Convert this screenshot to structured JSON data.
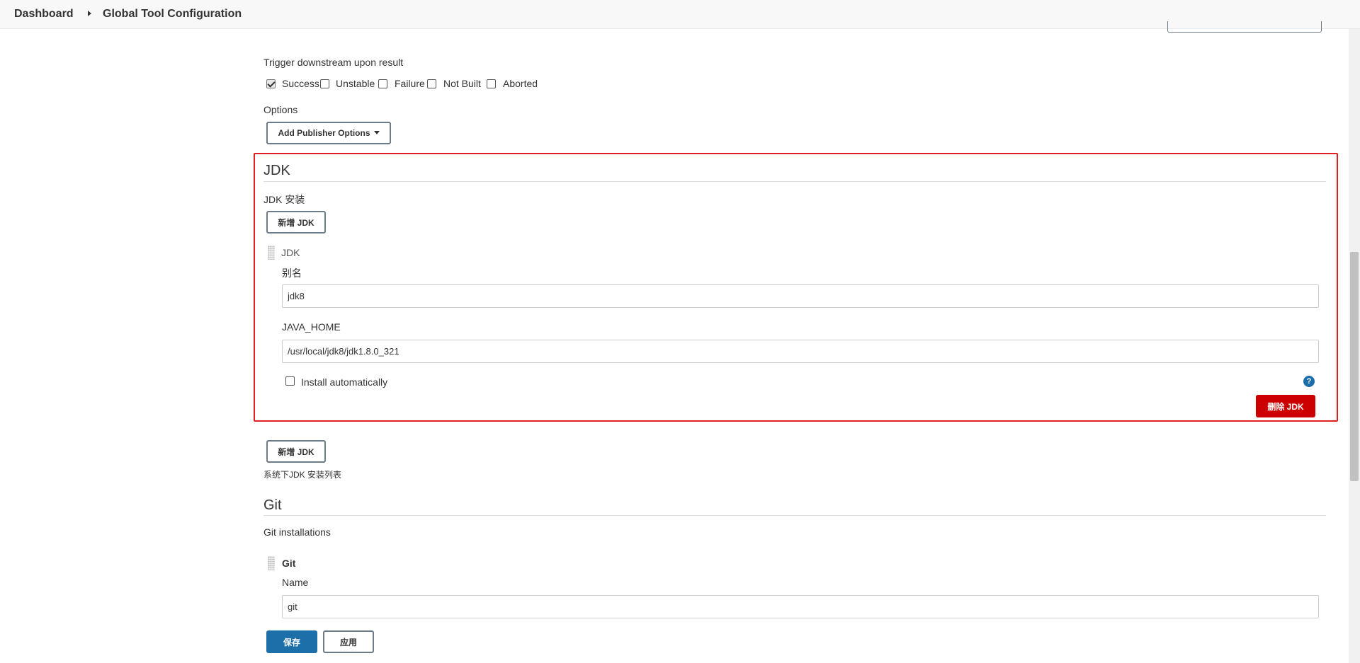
{
  "breadcrumb": {
    "home": "Dashboard",
    "current": "Global Tool Configuration"
  },
  "trigger": {
    "label": "Trigger downstream upon result",
    "options": [
      {
        "label": "Success",
        "checked": true
      },
      {
        "label": "Unstable",
        "checked": false
      },
      {
        "label": "Failure",
        "checked": false
      },
      {
        "label": "Not Built",
        "checked": false
      },
      {
        "label": "Aborted",
        "checked": false
      }
    ]
  },
  "options": {
    "label": "Options",
    "add_publisher_options": "Add Publisher Options"
  },
  "jdk": {
    "title": "JDK",
    "installations_label": "JDK 安装",
    "add_button": "新增 JDK",
    "item": {
      "header": "JDK",
      "alias_label": "别名",
      "alias_value": "jdk8",
      "java_home_label": "JAVA_HOME",
      "java_home_value": "/usr/local/jdk8/jdk1.8.0_321",
      "install_auto_label": "Install automatically",
      "install_auto_checked": false,
      "help": "?",
      "delete_button": "删除 JDK"
    },
    "add_button_bottom": "新增 JDK",
    "description": "系统下JDK 安装列表"
  },
  "git": {
    "title": "Git",
    "installations_label": "Git installations",
    "item": {
      "header": "Git",
      "name_label": "Name",
      "name_value": "git"
    }
  },
  "footer": {
    "save": "保存",
    "apply": "应用"
  },
  "colors": {
    "danger": "#cc0000",
    "primary": "#1c6fa8",
    "highlight_frame": "#e02020"
  }
}
